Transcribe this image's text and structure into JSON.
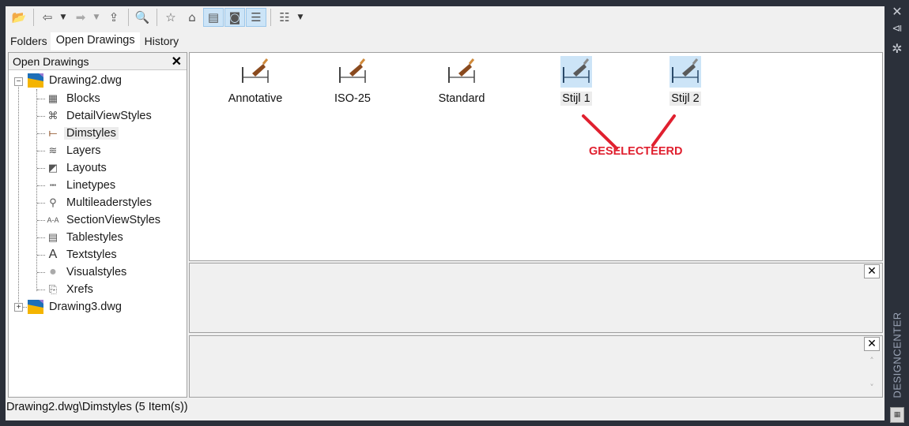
{
  "window": {
    "panel_title": "DESIGNCENTER",
    "side_icons": [
      "close-icon",
      "auto-hide-icon",
      "properties-icon"
    ]
  },
  "toolbar": {
    "buttons": [
      {
        "name": "load-button",
        "icon": "folder-open-icon",
        "glyph": "📂"
      },
      {
        "name": "back-button",
        "icon": "back-arrow-icon",
        "glyph": "⇦"
      },
      {
        "name": "forward-button",
        "icon": "forward-arrow-icon",
        "glyph": "➡"
      },
      {
        "name": "up-button",
        "icon": "up-folder-icon",
        "glyph": "⇪"
      },
      {
        "name": "search-button",
        "icon": "search-globe-icon",
        "glyph": "🔍"
      },
      {
        "name": "favorites-button",
        "icon": "favorites-folder-icon",
        "glyph": "☆"
      },
      {
        "name": "home-button",
        "icon": "home-icon",
        "glyph": "⌂"
      },
      {
        "name": "tree-view-toggle",
        "icon": "tree-view-icon",
        "glyph": "▤"
      },
      {
        "name": "preview-toggle",
        "icon": "preview-icon",
        "glyph": "◙"
      },
      {
        "name": "description-toggle",
        "icon": "description-icon",
        "glyph": "☰"
      },
      {
        "name": "views-button",
        "icon": "views-icon",
        "glyph": "☷"
      }
    ]
  },
  "tabs": [
    {
      "label": "Folders",
      "active": false
    },
    {
      "label": "Open Drawings",
      "active": true
    },
    {
      "label": "History",
      "active": false
    }
  ],
  "tree": {
    "header": "Open Drawings",
    "close_glyph": "✕",
    "drawings": [
      {
        "label": "Drawing2.dwg",
        "expanded": true,
        "expander": "−",
        "children": [
          {
            "label": "Blocks",
            "icon": "blocks-icon"
          },
          {
            "label": "DetailViewStyles",
            "icon": "detail-view-styles-icon"
          },
          {
            "label": "Dimstyles",
            "icon": "dimstyles-icon",
            "selected": true
          },
          {
            "label": "Layers",
            "icon": "layers-icon"
          },
          {
            "label": "Layouts",
            "icon": "layouts-icon"
          },
          {
            "label": "Linetypes",
            "icon": "linetypes-icon"
          },
          {
            "label": "Multileaderstyles",
            "icon": "multileaderstyles-icon"
          },
          {
            "label": "SectionViewStyles",
            "icon": "section-view-styles-icon"
          },
          {
            "label": "Tablestyles",
            "icon": "tablestyles-icon"
          },
          {
            "label": "Textstyles",
            "icon": "textstyles-icon"
          },
          {
            "label": "Visualstyles",
            "icon": "visualstyles-icon"
          },
          {
            "label": "Xrefs",
            "icon": "xrefs-icon"
          }
        ]
      },
      {
        "label": "Drawing3.dwg",
        "expanded": false,
        "expander": "+"
      }
    ]
  },
  "content": {
    "items": [
      {
        "label": "Annotative",
        "selected": false
      },
      {
        "label": "ISO-25",
        "selected": false
      },
      {
        "label": "Standard",
        "selected": false
      },
      {
        "label": "Stijl 1",
        "selected": true
      },
      {
        "label": "Stijl 2",
        "selected": true
      }
    ],
    "annotation": "GESELECTEERD",
    "annotation_color": "#e0202f"
  },
  "panes": {
    "close_glyph": "✕",
    "scroll_up": "˄",
    "scroll_down": "˅"
  },
  "status": "Drawing2.dwg\\Dimstyles (5 Item(s))"
}
